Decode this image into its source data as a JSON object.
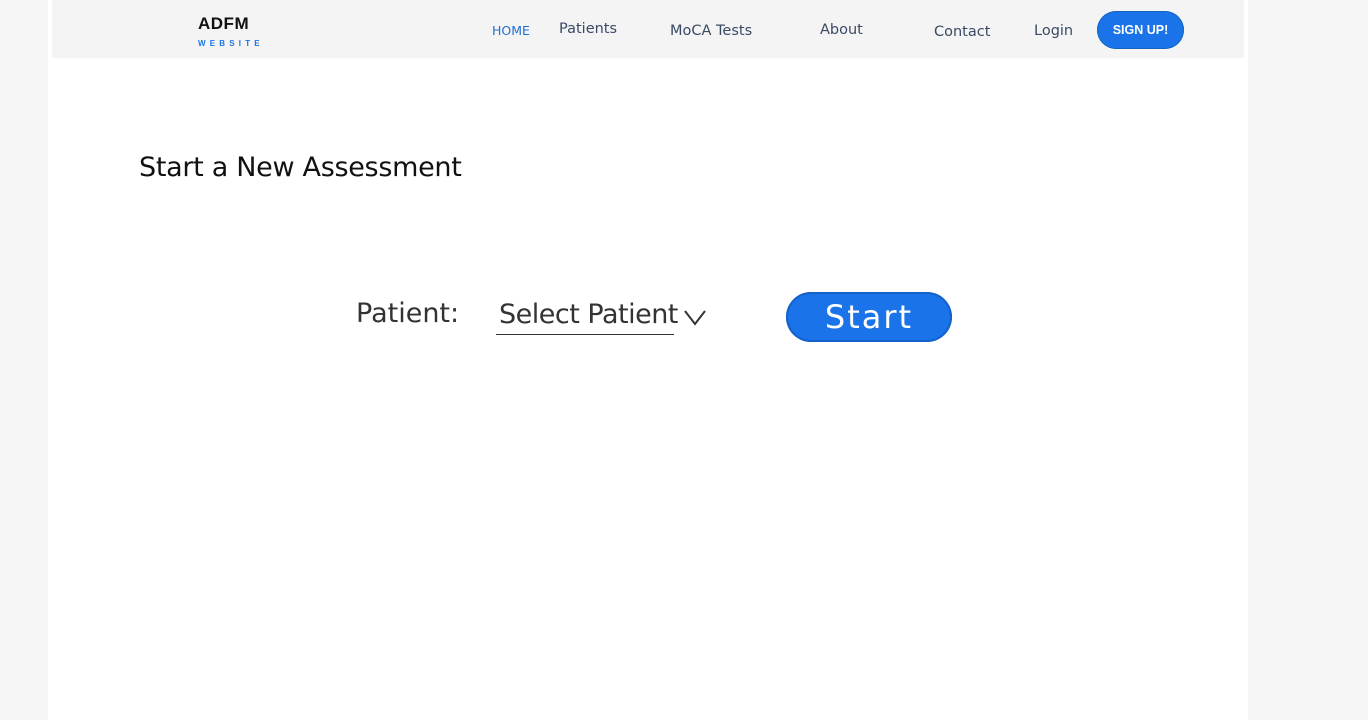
{
  "brand": {
    "name": "ADFM",
    "tagline": "WEBSITE"
  },
  "nav": {
    "home": "HOME",
    "patients": "Patients",
    "moca_tests": "MoCA Tests",
    "about": "About",
    "contact": "Contact",
    "login": "Login",
    "signup": "SIGN UP!"
  },
  "main": {
    "title": "Start a New Assessment",
    "patient_label": "Patient:",
    "patient_select": {
      "value": "Select Patient",
      "icon": "chevron-down-icon"
    },
    "start_button": "Start"
  },
  "colors": {
    "accent": "#1a73e8",
    "navbar_bg": "#f4f4f4",
    "page_bg": "#ffffff",
    "outer_bg": "#f6f6f6",
    "nav_text": "#3a4a63"
  }
}
